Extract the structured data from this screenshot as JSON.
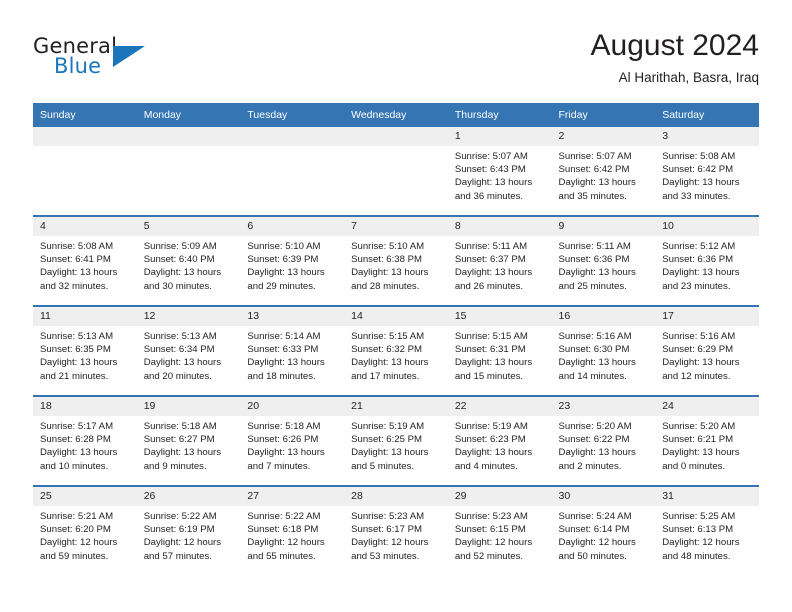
{
  "brand": {
    "name_part1": "General",
    "name_part2": "Blue",
    "flag_icon": "brand-triangle-icon"
  },
  "header": {
    "title": "August 2024",
    "subtitle": "Al Harithah, Basra, Iraq"
  },
  "colors": {
    "header_blue": "#3575b4",
    "brand_blue": "#1b75bb",
    "daynum_bg": "#efefef",
    "text": "#231f20",
    "cell_bg": "#ffffff"
  },
  "weekday_headers": [
    "Sunday",
    "Monday",
    "Tuesday",
    "Wednesday",
    "Thursday",
    "Friday",
    "Saturday"
  ],
  "labels": {
    "sunrise_prefix": "Sunrise:",
    "sunset_prefix": "Sunset:",
    "daylight_prefix": "Daylight:"
  },
  "weeks": [
    [
      {
        "day": "",
        "sunrise": "",
        "sunset": "",
        "daylight_line1": "",
        "daylight_line2": "",
        "empty": true
      },
      {
        "day": "",
        "sunrise": "",
        "sunset": "",
        "daylight_line1": "",
        "daylight_line2": "",
        "empty": true
      },
      {
        "day": "",
        "sunrise": "",
        "sunset": "",
        "daylight_line1": "",
        "daylight_line2": "",
        "empty": true
      },
      {
        "day": "",
        "sunrise": "",
        "sunset": "",
        "daylight_line1": "",
        "daylight_line2": "",
        "empty": true
      },
      {
        "day": "1",
        "sunrise": "Sunrise: 5:07 AM",
        "sunset": "Sunset: 6:43 PM",
        "daylight_line1": "Daylight: 13 hours",
        "daylight_line2": "and 36 minutes.",
        "empty": false
      },
      {
        "day": "2",
        "sunrise": "Sunrise: 5:07 AM",
        "sunset": "Sunset: 6:42 PM",
        "daylight_line1": "Daylight: 13 hours",
        "daylight_line2": "and 35 minutes.",
        "empty": false
      },
      {
        "day": "3",
        "sunrise": "Sunrise: 5:08 AM",
        "sunset": "Sunset: 6:42 PM",
        "daylight_line1": "Daylight: 13 hours",
        "daylight_line2": "and 33 minutes.",
        "empty": false
      }
    ],
    [
      {
        "day": "4",
        "sunrise": "Sunrise: 5:08 AM",
        "sunset": "Sunset: 6:41 PM",
        "daylight_line1": "Daylight: 13 hours",
        "daylight_line2": "and 32 minutes.",
        "empty": false
      },
      {
        "day": "5",
        "sunrise": "Sunrise: 5:09 AM",
        "sunset": "Sunset: 6:40 PM",
        "daylight_line1": "Daylight: 13 hours",
        "daylight_line2": "and 30 minutes.",
        "empty": false
      },
      {
        "day": "6",
        "sunrise": "Sunrise: 5:10 AM",
        "sunset": "Sunset: 6:39 PM",
        "daylight_line1": "Daylight: 13 hours",
        "daylight_line2": "and 29 minutes.",
        "empty": false
      },
      {
        "day": "7",
        "sunrise": "Sunrise: 5:10 AM",
        "sunset": "Sunset: 6:38 PM",
        "daylight_line1": "Daylight: 13 hours",
        "daylight_line2": "and 28 minutes.",
        "empty": false
      },
      {
        "day": "8",
        "sunrise": "Sunrise: 5:11 AM",
        "sunset": "Sunset: 6:37 PM",
        "daylight_line1": "Daylight: 13 hours",
        "daylight_line2": "and 26 minutes.",
        "empty": false
      },
      {
        "day": "9",
        "sunrise": "Sunrise: 5:11 AM",
        "sunset": "Sunset: 6:36 PM",
        "daylight_line1": "Daylight: 13 hours",
        "daylight_line2": "and 25 minutes.",
        "empty": false
      },
      {
        "day": "10",
        "sunrise": "Sunrise: 5:12 AM",
        "sunset": "Sunset: 6:36 PM",
        "daylight_line1": "Daylight: 13 hours",
        "daylight_line2": "and 23 minutes.",
        "empty": false
      }
    ],
    [
      {
        "day": "11",
        "sunrise": "Sunrise: 5:13 AM",
        "sunset": "Sunset: 6:35 PM",
        "daylight_line1": "Daylight: 13 hours",
        "daylight_line2": "and 21 minutes.",
        "empty": false
      },
      {
        "day": "12",
        "sunrise": "Sunrise: 5:13 AM",
        "sunset": "Sunset: 6:34 PM",
        "daylight_line1": "Daylight: 13 hours",
        "daylight_line2": "and 20 minutes.",
        "empty": false
      },
      {
        "day": "13",
        "sunrise": "Sunrise: 5:14 AM",
        "sunset": "Sunset: 6:33 PM",
        "daylight_line1": "Daylight: 13 hours",
        "daylight_line2": "and 18 minutes.",
        "empty": false
      },
      {
        "day": "14",
        "sunrise": "Sunrise: 5:15 AM",
        "sunset": "Sunset: 6:32 PM",
        "daylight_line1": "Daylight: 13 hours",
        "daylight_line2": "and 17 minutes.",
        "empty": false
      },
      {
        "day": "15",
        "sunrise": "Sunrise: 5:15 AM",
        "sunset": "Sunset: 6:31 PM",
        "daylight_line1": "Daylight: 13 hours",
        "daylight_line2": "and 15 minutes.",
        "empty": false
      },
      {
        "day": "16",
        "sunrise": "Sunrise: 5:16 AM",
        "sunset": "Sunset: 6:30 PM",
        "daylight_line1": "Daylight: 13 hours",
        "daylight_line2": "and 14 minutes.",
        "empty": false
      },
      {
        "day": "17",
        "sunrise": "Sunrise: 5:16 AM",
        "sunset": "Sunset: 6:29 PM",
        "daylight_line1": "Daylight: 13 hours",
        "daylight_line2": "and 12 minutes.",
        "empty": false
      }
    ],
    [
      {
        "day": "18",
        "sunrise": "Sunrise: 5:17 AM",
        "sunset": "Sunset: 6:28 PM",
        "daylight_line1": "Daylight: 13 hours",
        "daylight_line2": "and 10 minutes.",
        "empty": false
      },
      {
        "day": "19",
        "sunrise": "Sunrise: 5:18 AM",
        "sunset": "Sunset: 6:27 PM",
        "daylight_line1": "Daylight: 13 hours",
        "daylight_line2": "and 9 minutes.",
        "empty": false
      },
      {
        "day": "20",
        "sunrise": "Sunrise: 5:18 AM",
        "sunset": "Sunset: 6:26 PM",
        "daylight_line1": "Daylight: 13 hours",
        "daylight_line2": "and 7 minutes.",
        "empty": false
      },
      {
        "day": "21",
        "sunrise": "Sunrise: 5:19 AM",
        "sunset": "Sunset: 6:25 PM",
        "daylight_line1": "Daylight: 13 hours",
        "daylight_line2": "and 5 minutes.",
        "empty": false
      },
      {
        "day": "22",
        "sunrise": "Sunrise: 5:19 AM",
        "sunset": "Sunset: 6:23 PM",
        "daylight_line1": "Daylight: 13 hours",
        "daylight_line2": "and 4 minutes.",
        "empty": false
      },
      {
        "day": "23",
        "sunrise": "Sunrise: 5:20 AM",
        "sunset": "Sunset: 6:22 PM",
        "daylight_line1": "Daylight: 13 hours",
        "daylight_line2": "and 2 minutes.",
        "empty": false
      },
      {
        "day": "24",
        "sunrise": "Sunrise: 5:20 AM",
        "sunset": "Sunset: 6:21 PM",
        "daylight_line1": "Daylight: 13 hours",
        "daylight_line2": "and 0 minutes.",
        "empty": false
      }
    ],
    [
      {
        "day": "25",
        "sunrise": "Sunrise: 5:21 AM",
        "sunset": "Sunset: 6:20 PM",
        "daylight_line1": "Daylight: 12 hours",
        "daylight_line2": "and 59 minutes.",
        "empty": false
      },
      {
        "day": "26",
        "sunrise": "Sunrise: 5:22 AM",
        "sunset": "Sunset: 6:19 PM",
        "daylight_line1": "Daylight: 12 hours",
        "daylight_line2": "and 57 minutes.",
        "empty": false
      },
      {
        "day": "27",
        "sunrise": "Sunrise: 5:22 AM",
        "sunset": "Sunset: 6:18 PM",
        "daylight_line1": "Daylight: 12 hours",
        "daylight_line2": "and 55 minutes.",
        "empty": false
      },
      {
        "day": "28",
        "sunrise": "Sunrise: 5:23 AM",
        "sunset": "Sunset: 6:17 PM",
        "daylight_line1": "Daylight: 12 hours",
        "daylight_line2": "and 53 minutes.",
        "empty": false
      },
      {
        "day": "29",
        "sunrise": "Sunrise: 5:23 AM",
        "sunset": "Sunset: 6:15 PM",
        "daylight_line1": "Daylight: 12 hours",
        "daylight_line2": "and 52 minutes.",
        "empty": false
      },
      {
        "day": "30",
        "sunrise": "Sunrise: 5:24 AM",
        "sunset": "Sunset: 6:14 PM",
        "daylight_line1": "Daylight: 12 hours",
        "daylight_line2": "and 50 minutes.",
        "empty": false
      },
      {
        "day": "31",
        "sunrise": "Sunrise: 5:25 AM",
        "sunset": "Sunset: 6:13 PM",
        "daylight_line1": "Daylight: 12 hours",
        "daylight_line2": "and 48 minutes.",
        "empty": false
      }
    ]
  ]
}
